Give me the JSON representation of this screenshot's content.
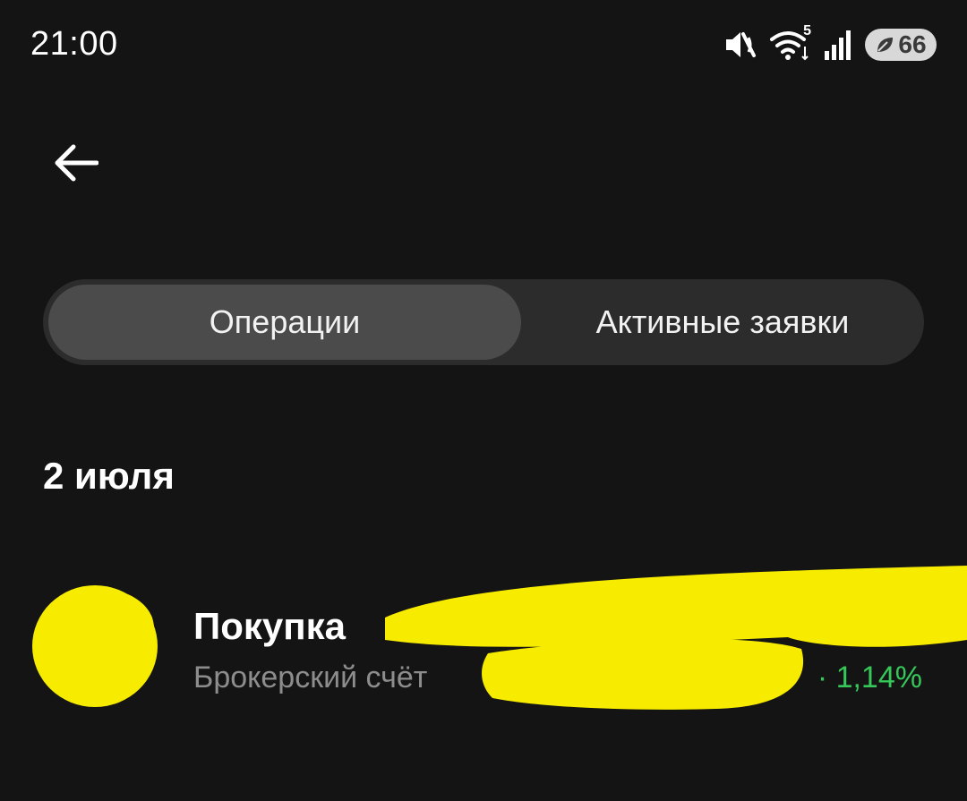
{
  "status_bar": {
    "time": "21:00",
    "wifi_badge": "5",
    "battery_level": "66",
    "icons": [
      "mute-icon",
      "wifi-icon",
      "signal-icon",
      "battery-icon",
      "leaf-icon"
    ]
  },
  "navigation": {
    "back_icon": "arrow-left-icon"
  },
  "tabs": [
    {
      "label": "Операции",
      "active": true
    },
    {
      "label": "Активные заявки",
      "active": false
    }
  ],
  "operations": {
    "date_header": "2 июля",
    "items": [
      {
        "title": "Покупка",
        "subtitle": "Брокерский счёт",
        "change": "· 1,14%"
      }
    ]
  },
  "colors": {
    "background": "#141414",
    "segment_bg": "#2c2c2c",
    "segment_active": "#4b4b4b",
    "positive": "#35c759",
    "redaction": "#f7ec00"
  }
}
